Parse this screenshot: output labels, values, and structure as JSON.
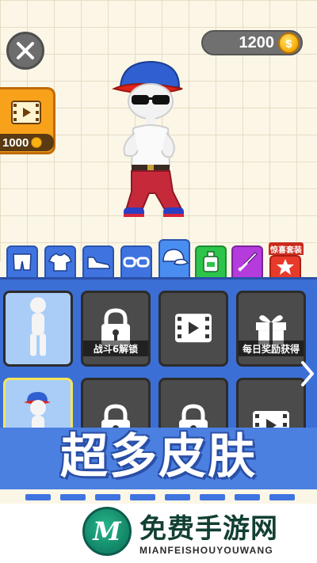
{
  "hud": {
    "coins": "1200",
    "coin_symbol": "$",
    "video_reward_price": "1000"
  },
  "tabs": [
    {
      "name": "shorts-tab-icon",
      "active": false
    },
    {
      "name": "tshirt-tab-icon",
      "active": false
    },
    {
      "name": "shoe-tab-icon",
      "active": false
    },
    {
      "name": "glasses-tab-icon",
      "active": false
    },
    {
      "name": "cap-tab-icon",
      "active": true
    },
    {
      "name": "bottle-tab-icon",
      "active": false
    },
    {
      "name": "weapon-tab-icon",
      "active": false
    },
    {
      "name": "star-tab-icon",
      "active": false
    }
  ],
  "tab_badge": "惊喜套装",
  "skins": [
    {
      "caption": "",
      "state": "owned"
    },
    {
      "caption": "战斗6解锁",
      "state": "locked"
    },
    {
      "caption": "",
      "state": "video"
    },
    {
      "caption": "每日奖励获得",
      "state": "gift"
    }
  ],
  "banner": {
    "title": "超多皮肤"
  },
  "watermark": {
    "logo_letter": "M",
    "cn": "免费手游网",
    "en": "MIANFEISHOUYOUWANG"
  },
  "colors": {
    "panel": "#3c6fd6",
    "tab_active": "#4a8df0",
    "coin": "#f6b312",
    "cap_red": "#e0241b",
    "cap_blue": "#2f5fd0"
  }
}
